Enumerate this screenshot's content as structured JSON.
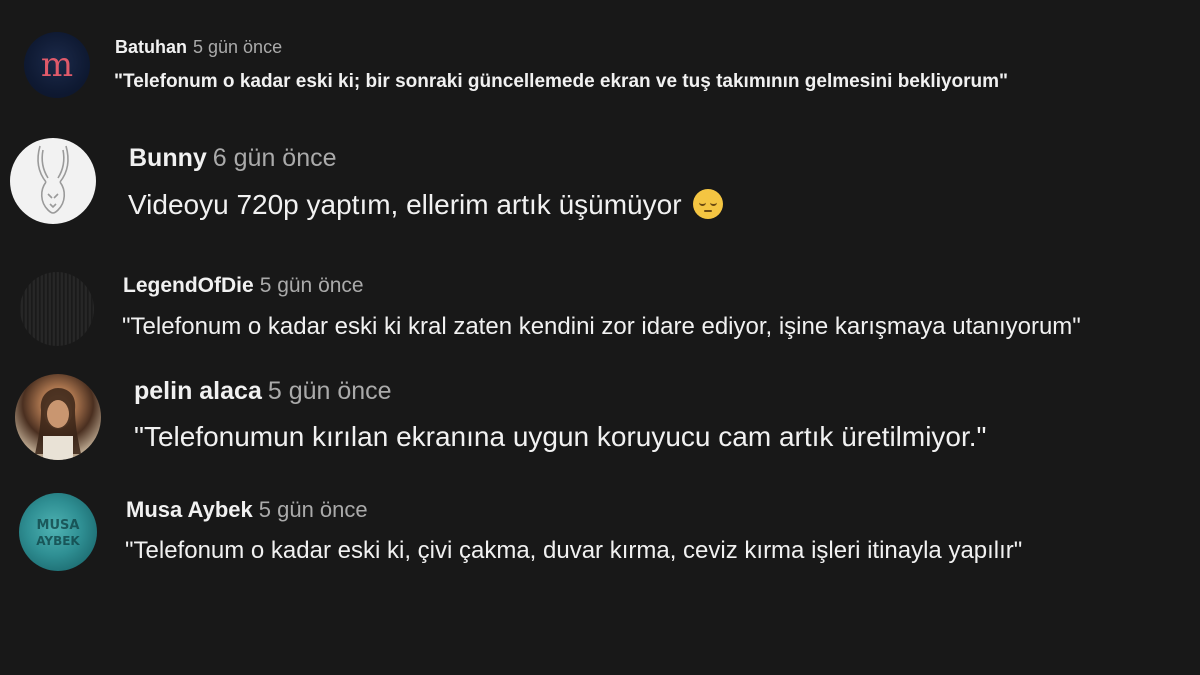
{
  "comments": [
    {
      "author": "Batuhan",
      "time": "5 gün önce",
      "text": "\"Telefonum o kadar eski ki; bir sonraki güncellemede ekran ve tuş takımının gelmesini bekliyorum\"",
      "avatar_letter": "m",
      "avatar_color": "#0f1a33"
    },
    {
      "author": "Bunny",
      "time": "6 gün önce",
      "text": "Videoyu 720p yaptım, ellerim artık üşümüyor",
      "emoji": "pensive-face",
      "avatar_color": "#f2f2f2"
    },
    {
      "author": "LegendOfDie",
      "time": "5 gün önce",
      "text": "\"Telefonum o kadar eski ki kral zaten kendini zor idare ediyor, işine karışmaya utanıyorum\"",
      "avatar_color": "#1e1e1e"
    },
    {
      "author": "pelin alaca",
      "time": "5 gün önce",
      "text": "\"Telefonumun kırılan ekranına uygun koruyucu cam artık üretilmiyor.\"",
      "avatar_color": "#a8734d"
    },
    {
      "author": "Musa Aybek",
      "time": "5 gün önce",
      "text": "\"Telefonum o kadar eski ki, çivi çakma, duvar kırma, ceviz kırma işleri itinayla yapılır\"",
      "avatar_text": "MUSA AYBEK",
      "avatar_color": "#2f8f93"
    }
  ],
  "colors": {
    "background": "#181818",
    "author": "#f1f1f1",
    "time": "#aaaaaa",
    "text": "#f1f1f1"
  }
}
